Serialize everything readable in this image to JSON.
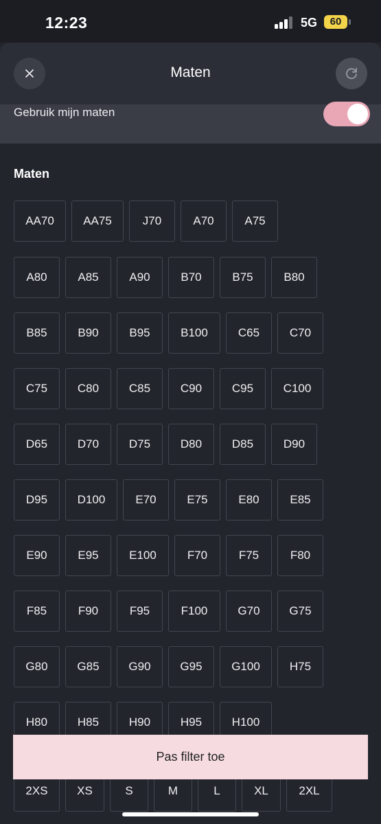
{
  "status_bar": {
    "time": "12:23",
    "network": "5G",
    "battery": "60"
  },
  "header": {
    "title": "Maten",
    "close_icon": "close-icon",
    "reset_icon": "refresh-icon"
  },
  "toggle": {
    "label": "Gebruik mijn maten",
    "on": true
  },
  "section": {
    "title": "Maten"
  },
  "sizes": [
    [
      "AA70",
      "AA75",
      "J70",
      "A70",
      "A75"
    ],
    [
      "A80",
      "A85",
      "A90",
      "B70",
      "B75",
      "B80"
    ],
    [
      "B85",
      "B90",
      "B95",
      "B100",
      "C65",
      "C70"
    ],
    [
      "C75",
      "C80",
      "C85",
      "C90",
      "C95",
      "C100"
    ],
    [
      "D65",
      "D70",
      "D75",
      "D80",
      "D85",
      "D90"
    ],
    [
      "D95",
      "D100",
      "E70",
      "E75",
      "E80",
      "E85"
    ],
    [
      "E90",
      "E95",
      "E100",
      "F70",
      "F75",
      "F80"
    ],
    [
      "F85",
      "F90",
      "F95",
      "F100",
      "G70",
      "G75"
    ],
    [
      "G80",
      "G85",
      "G90",
      "G95",
      "G100",
      "H75"
    ],
    [
      "H80",
      "H85",
      "H90",
      "H95",
      "H100"
    ],
    [
      "2XS",
      "XS",
      "S",
      "M",
      "L",
      "XL",
      "2XL"
    ]
  ],
  "apply_button": {
    "label": "Pas filter toe"
  },
  "colors": {
    "accent": "#e9a7b6",
    "apply_bg": "#f6dce1",
    "background": "#23252d"
  }
}
